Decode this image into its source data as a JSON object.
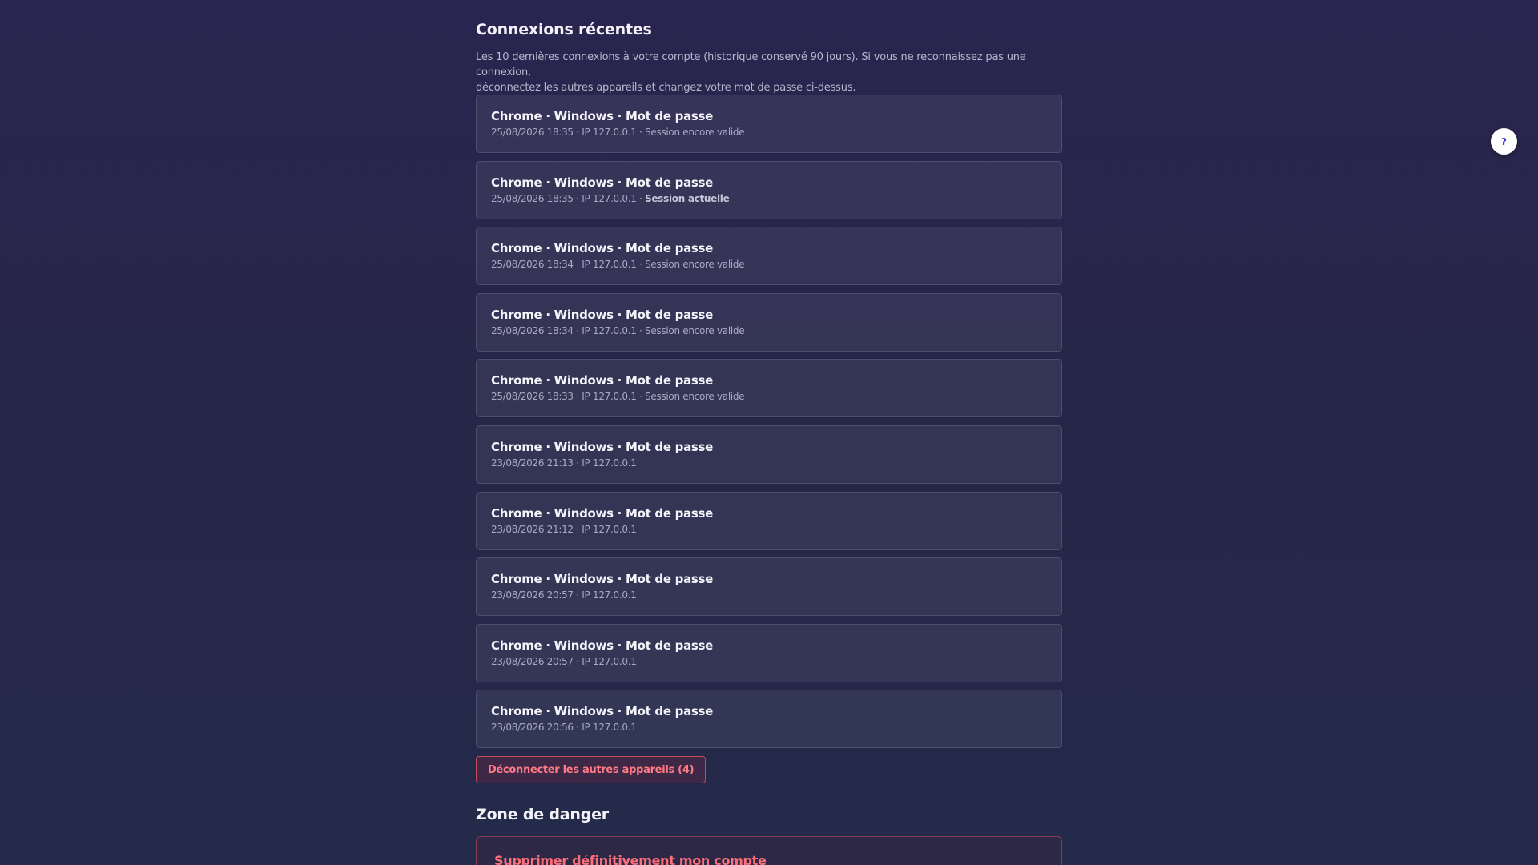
{
  "recent": {
    "title": "Connexions récentes",
    "intro_line1": "Les 10 dernières connexions à votre compte (historique conservé 90 jours). Si vous ne reconnaissez pas une connexion,",
    "intro_line2": "déconnectez les autres appareils et changez votre mot de passe ci-dessus.",
    "sessions": [
      {
        "title": "Chrome · Windows · Mot de passe",
        "meta": "25/08/2026 18:35 · IP 127.0.0.1 · ",
        "status": "Session encore valide",
        "current": false
      },
      {
        "title": "Chrome · Windows · Mot de passe",
        "meta": "25/08/2026 18:35 · IP 127.0.0.1 · ",
        "status": "Session actuelle",
        "current": true
      },
      {
        "title": "Chrome · Windows · Mot de passe",
        "meta": "25/08/2026 18:34 · IP 127.0.0.1 · ",
        "status": "Session encore valide",
        "current": false
      },
      {
        "title": "Chrome · Windows · Mot de passe",
        "meta": "25/08/2026 18:34 · IP 127.0.0.1 · ",
        "status": "Session encore valide",
        "current": false
      },
      {
        "title": "Chrome · Windows · Mot de passe",
        "meta": "25/08/2026 18:33 · IP 127.0.0.1 · ",
        "status": "Session encore valide",
        "current": false
      },
      {
        "title": "Chrome · Windows · Mot de passe",
        "meta": "23/08/2026 21:13 · IP 127.0.0.1",
        "status": "",
        "current": false
      },
      {
        "title": "Chrome · Windows · Mot de passe",
        "meta": "23/08/2026 21:12 · IP 127.0.0.1",
        "status": "",
        "current": false
      },
      {
        "title": "Chrome · Windows · Mot de passe",
        "meta": "23/08/2026 20:57 · IP 127.0.0.1",
        "status": "",
        "current": false
      },
      {
        "title": "Chrome · Windows · Mot de passe",
        "meta": "23/08/2026 20:57 · IP 127.0.0.1",
        "status": "",
        "current": false
      },
      {
        "title": "Chrome · Windows · Mot de passe",
        "meta": "23/08/2026 20:56 · IP 127.0.0.1",
        "status": "",
        "current": false
      }
    ],
    "logout_label": "Déconnecter les autres appareils (4)"
  },
  "danger": {
    "title": "Zone de danger",
    "delete_heading": "Supprimer définitivement mon compte"
  },
  "help": {
    "label": "?",
    "icon": "question-mark-icon"
  },
  "colors": {
    "accent_danger": "#ff6f7a",
    "help_icon": "#3a3ac8"
  }
}
